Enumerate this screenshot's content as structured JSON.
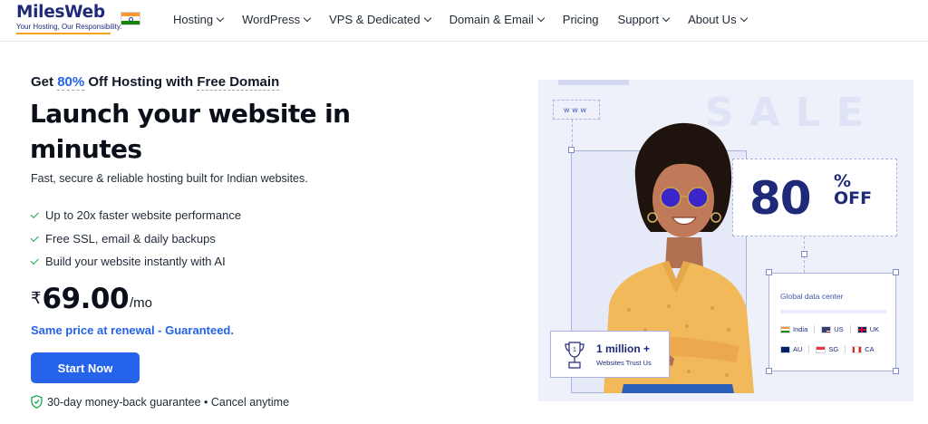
{
  "brand": {
    "name": "MilesWeb",
    "tagline": "Your Hosting, Our Responsibility.",
    "accent_color": "#2563eb",
    "navy_color": "#1e2a78"
  },
  "nav": {
    "items": [
      {
        "label": "Hosting",
        "has_dropdown": true
      },
      {
        "label": "WordPress",
        "has_dropdown": true
      },
      {
        "label": "VPS & Dedicated",
        "has_dropdown": true
      },
      {
        "label": "Domain & Email",
        "has_dropdown": true
      },
      {
        "label": "Pricing",
        "has_dropdown": false
      },
      {
        "label": "Support",
        "has_dropdown": true
      },
      {
        "label": "About Us",
        "has_dropdown": true
      }
    ]
  },
  "hero": {
    "eyebrow_prefix": "Get ",
    "eyebrow_accent": "80%",
    "eyebrow_middle": " Off Hosting with ",
    "eyebrow_suffix": "Free Domain",
    "headline": "Launch your website in minutes",
    "subtext": "Fast, secure & reliable hosting built for Indian websites.",
    "features": [
      "Up to 20x faster website performance",
      "Free SSL, email & daily backups",
      "Build your website instantly with AI"
    ],
    "price": {
      "currency": "₹",
      "amount": "69.00",
      "period": "/mo"
    },
    "renewal_note": "Same price at renewal - Guaranteed.",
    "cta_label": "Start Now",
    "guarantee": "30-day money-back guarantee • Cancel anytime"
  },
  "art": {
    "www_label": "www",
    "sale_text": "SALE",
    "discount": {
      "number": "80",
      "percent": "%",
      "word": "OFF"
    },
    "data_center": {
      "title": "Global data center",
      "row1": [
        "India",
        "US",
        "UK"
      ],
      "row2": [
        "AU",
        "SG",
        "CA"
      ]
    },
    "trust": {
      "count": "1 million +",
      "label": "Websites Trust Us"
    }
  }
}
